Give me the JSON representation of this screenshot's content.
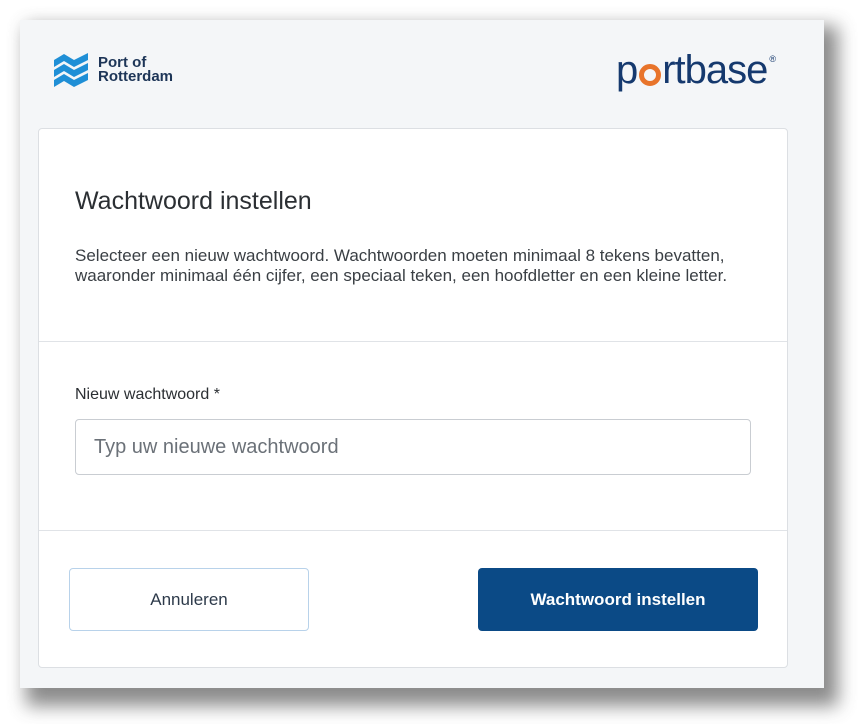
{
  "header": {
    "left_logo": {
      "icon": "port-of-rotterdam-waves-icon",
      "line1": "Port of",
      "line2": "Rotterdam",
      "color": "#1f8fd6"
    },
    "right_logo": {
      "pre": "p",
      "post": "rtbase",
      "reg": "®",
      "color": "#15396e",
      "accent": "#e8742b"
    }
  },
  "dialog": {
    "title": "Wachtwoord instellen",
    "description": "Selecteer een nieuw wachtwoord. Wachtwoorden moeten minimaal 8 tekens bevatten, waaronder minimaal één cijfer, een speciaal teken, een hoofdletter en een kleine letter.",
    "field": {
      "label": "Nieuw wachtwoord *",
      "value": "",
      "placeholder": "Typ uw nieuwe wachtwoord"
    },
    "buttons": {
      "cancel": "Annuleren",
      "submit": "Wachtwoord instellen"
    },
    "colors": {
      "primary": "#0b4a86",
      "cancel_border": "#b8d2ea"
    }
  }
}
